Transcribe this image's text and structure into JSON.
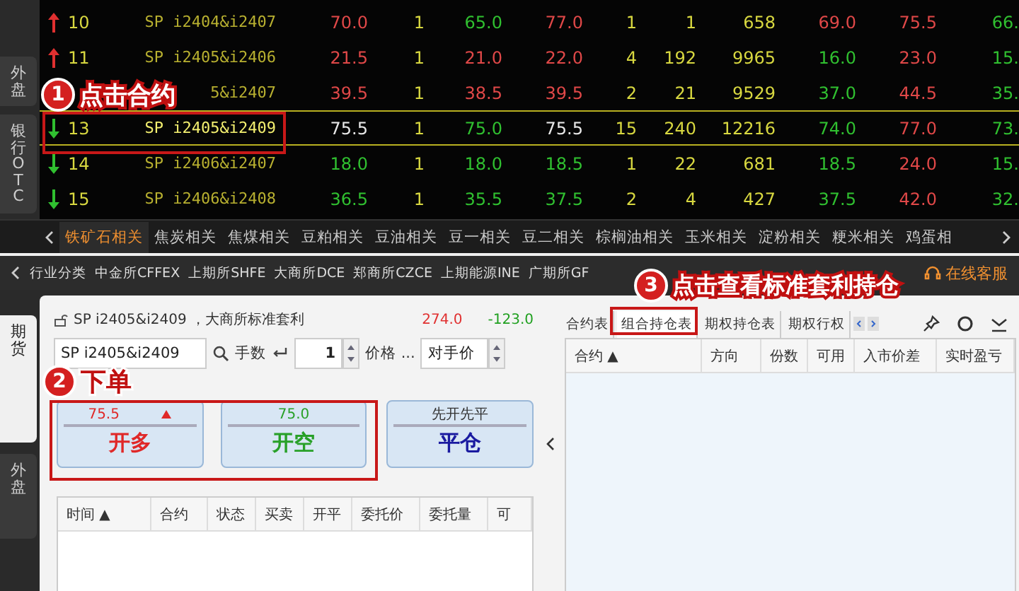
{
  "side_tabs_top": [
    {
      "label": "外盘",
      "selected": false
    },
    {
      "label": "银行OTC",
      "selected": false
    }
  ],
  "quotes": [
    {
      "num": "10",
      "rising": true,
      "selected": false,
      "contract": "SP i2404&i2407",
      "cells": [
        {
          "text": "70.0",
          "color": "#e04848"
        },
        {
          "text": "1",
          "color": "#d8d840"
        },
        {
          "text": "65.0",
          "color": "#30c030"
        },
        {
          "text": "77.0",
          "color": "#e04848"
        },
        {
          "text": "1",
          "color": "#d8d840"
        },
        {
          "text": "1",
          "color": "#d8d840"
        },
        {
          "text": "658",
          "color": "#d8d840"
        },
        {
          "text": "69.0",
          "color": "#e04848"
        },
        {
          "text": "75.5",
          "color": "#e04848"
        },
        {
          "text": "66.",
          "color": "#30c030"
        }
      ]
    },
    {
      "num": "11",
      "rising": true,
      "selected": false,
      "contract": "SP i2405&i2406",
      "cells": [
        {
          "text": "21.5",
          "color": "#e04848"
        },
        {
          "text": "1",
          "color": "#d8d840"
        },
        {
          "text": "21.0",
          "color": "#e04848"
        },
        {
          "text": "22.0",
          "color": "#e04848"
        },
        {
          "text": "4",
          "color": "#d8d840"
        },
        {
          "text": "192",
          "color": "#d8d840"
        },
        {
          "text": "9965",
          "color": "#d8d840"
        },
        {
          "text": "16.0",
          "color": "#30c030"
        },
        {
          "text": "23.0",
          "color": "#e04848"
        },
        {
          "text": "15.",
          "color": "#30c030"
        }
      ]
    },
    {
      "selected": false,
      "contract": "5&i2407",
      "cells": [
        {
          "text": "39.5",
          "color": "#e04848"
        },
        {
          "text": "1",
          "color": "#d8d840"
        },
        {
          "text": "38.5",
          "color": "#e04848"
        },
        {
          "text": "39.5",
          "color": "#e04848"
        },
        {
          "text": "2",
          "color": "#d8d840"
        },
        {
          "text": "21",
          "color": "#d8d840"
        },
        {
          "text": "9529",
          "color": "#d8d840"
        },
        {
          "text": "37.0",
          "color": "#30c030"
        },
        {
          "text": "44.5",
          "color": "#e04848"
        },
        {
          "text": "35.",
          "color": "#30c030"
        }
      ]
    },
    {
      "num": "13",
      "rising": false,
      "selected": true,
      "contract": "SP i2405&i2409",
      "cells": [
        {
          "text": "75.5",
          "color": "#e8e8e8"
        },
        {
          "text": "1",
          "color": "#d8d840"
        },
        {
          "text": "75.0",
          "color": "#30c030"
        },
        {
          "text": "75.5",
          "color": "#e8e8e8"
        },
        {
          "text": "15",
          "color": "#d8d840"
        },
        {
          "text": "240",
          "color": "#d8d840"
        },
        {
          "text": "12216",
          "color": "#d8d840"
        },
        {
          "text": "74.0",
          "color": "#30c030"
        },
        {
          "text": "77.0",
          "color": "#e04848"
        },
        {
          "text": "73.",
          "color": "#30c030"
        }
      ]
    },
    {
      "num": "14",
      "rising": false,
      "selected": false,
      "contract": "SP i2406&i2407",
      "cells": [
        {
          "text": "18.0",
          "color": "#30c030"
        },
        {
          "text": "1",
          "color": "#d8d840"
        },
        {
          "text": "18.0",
          "color": "#30c030"
        },
        {
          "text": "18.5",
          "color": "#30c030"
        },
        {
          "text": "1",
          "color": "#d8d840"
        },
        {
          "text": "22",
          "color": "#d8d840"
        },
        {
          "text": "681",
          "color": "#d8d840"
        },
        {
          "text": "18.5",
          "color": "#30c030"
        },
        {
          "text": "24.0",
          "color": "#e04848"
        },
        {
          "text": "15.",
          "color": "#30c030"
        }
      ]
    },
    {
      "num": "15",
      "rising": false,
      "selected": false,
      "contract": "SP i2406&i2408",
      "cells": [
        {
          "text": "36.5",
          "color": "#30c030"
        },
        {
          "text": "1",
          "color": "#d8d840"
        },
        {
          "text": "35.5",
          "color": "#30c030"
        },
        {
          "text": "37.5",
          "color": "#30c030"
        },
        {
          "text": "2",
          "color": "#d8d840"
        },
        {
          "text": "4",
          "color": "#d8d840"
        },
        {
          "text": "427",
          "color": "#d8d840"
        },
        {
          "text": "37.5",
          "color": "#30c030"
        },
        {
          "text": "42.0",
          "color": "#e04848"
        },
        {
          "text": "32.",
          "color": "#30c030"
        }
      ]
    }
  ],
  "category_tabs": [
    {
      "label": "铁矿石相关",
      "selected": true
    },
    {
      "label": "焦炭相关",
      "selected": false
    },
    {
      "label": "焦煤相关",
      "selected": false
    },
    {
      "label": "豆粕相关",
      "selected": false
    },
    {
      "label": "豆油相关",
      "selected": false
    },
    {
      "label": "豆一相关",
      "selected": false
    },
    {
      "label": "豆二相关",
      "selected": false
    },
    {
      "label": "棕榈油相关",
      "selected": false
    },
    {
      "label": "玉米相关",
      "selected": false
    },
    {
      "label": "淀粉相关",
      "selected": false
    },
    {
      "label": "粳米相关",
      "selected": false
    },
    {
      "label": "鸡蛋相",
      "selected": false
    }
  ],
  "exchange_tabs": [
    "行业分类",
    "中金所CFFEX",
    "上期所SHFE",
    "大商所DCE",
    "郑商所CZCE",
    "上期能源INE",
    "广期所GF"
  ],
  "support_link": "在线客服",
  "side_tabs_bottom": [
    {
      "label": "期货",
      "selected": true
    },
    {
      "label": "外盘",
      "selected": false
    }
  ],
  "order": {
    "title": "SP i2405&i2409 ，大商所标准套利",
    "value_1": "274.0",
    "value_2": "-123.0",
    "contract": "SP i2405&i2409",
    "qty_label": "手数",
    "qty": "1",
    "price_label": "价格 ...",
    "price": "对手价",
    "buttons": [
      {
        "kind": "buy",
        "price": "75.5",
        "label": "开多"
      },
      {
        "kind": "sell",
        "price": "75.0",
        "label": "开空"
      },
      {
        "kind": "close",
        "price": "先开先平",
        "label": "平仓"
      }
    ],
    "columns": [
      "时间 ▲",
      "合约",
      "状态",
      "买卖",
      "开平",
      "委托价",
      "委托量",
      "可"
    ]
  },
  "positions": {
    "tabs": [
      {
        "label": "合约表",
        "selected": false
      },
      {
        "label": "组合持仓表",
        "selected": true
      },
      {
        "label": "期权持仓表",
        "selected": false
      },
      {
        "label": "期权行权",
        "selected": false
      }
    ],
    "columns": [
      "合约 ▲",
      "方向",
      "份数",
      "可用",
      "入市价差",
      "实时盈亏"
    ]
  },
  "annotations": [
    {
      "number": "1",
      "text": "点击合约"
    },
    {
      "number": "2",
      "text": "下单"
    },
    {
      "number": "3",
      "text": "点击查看标准套利持仓"
    }
  ]
}
